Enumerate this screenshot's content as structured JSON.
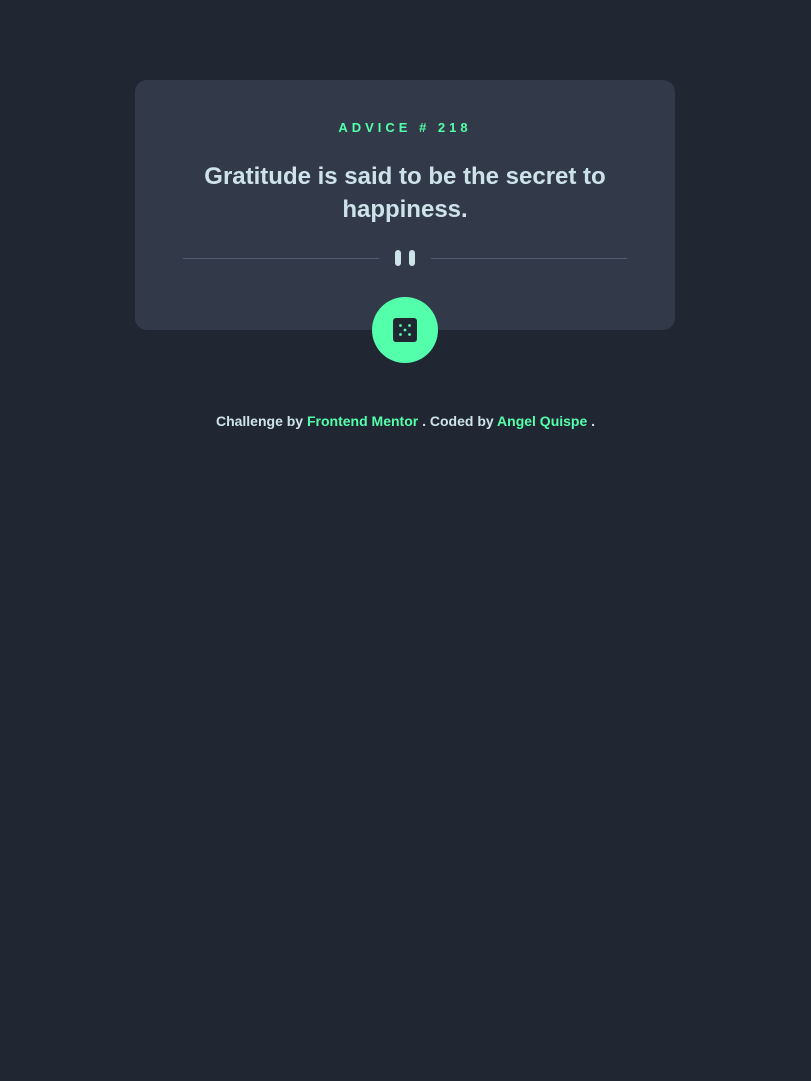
{
  "card": {
    "advice_label": "ADVICE # 218",
    "quote": "Gratitude is said to be the secret to happiness."
  },
  "icons": {
    "divider": "pause-icon",
    "button": "dice-icon"
  },
  "attribution": {
    "prefix": "Challenge by",
    "link1": "Frontend Mentor",
    "middle": ". Coded by",
    "link2": "Angel Quispe",
    "suffix": "."
  },
  "colors": {
    "background": "#202632",
    "card": "#323a49",
    "accent": "#53ffaa",
    "text": "#cee3e9",
    "divider": "#4f5d74"
  }
}
